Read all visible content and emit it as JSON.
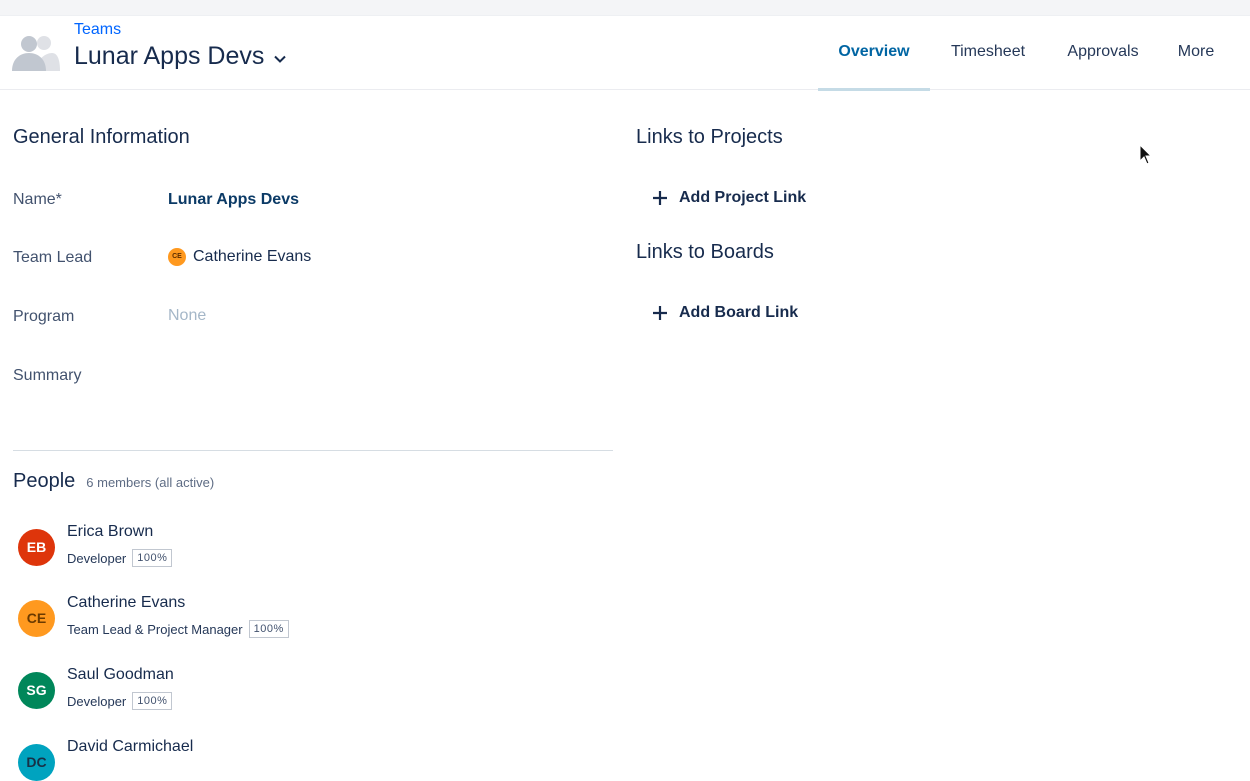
{
  "header": {
    "breadcrumb": "Teams",
    "team_name": "Lunar Apps Devs",
    "icons": {
      "team": "team-people-icon",
      "dropdown": "chevron-down-icon"
    },
    "tabs": [
      {
        "label": "Overview",
        "active": true
      },
      {
        "label": "Timesheet",
        "active": false
      },
      {
        "label": "Approvals",
        "active": false
      },
      {
        "label": "More",
        "active": false
      }
    ]
  },
  "general": {
    "title": "General Information",
    "fields": {
      "name": {
        "label": "Name*",
        "value": "Lunar Apps Devs"
      },
      "team_lead": {
        "label": "Team Lead",
        "value": "Catherine Evans",
        "initials": "CE"
      },
      "program": {
        "label": "Program",
        "value": "None"
      },
      "summary": {
        "label": "Summary",
        "value": ""
      }
    }
  },
  "people": {
    "title": "People",
    "count_text": "6 members (all active)",
    "members": [
      {
        "initials": "EB",
        "name": "Erica Brown",
        "role": "Developer",
        "allocation": "100%",
        "color": "#de350b"
      },
      {
        "initials": "CE",
        "name": "Catherine Evans",
        "role": "Team Lead & Project Manager",
        "allocation": "100%",
        "color": "#ff991f"
      },
      {
        "initials": "SG",
        "name": "Saul Goodman",
        "role": "Developer",
        "allocation": "100%",
        "color": "#00875a"
      },
      {
        "initials": "DC",
        "name": "David Carmichael",
        "role": "",
        "allocation": "",
        "color": "#00a3bf"
      }
    ]
  },
  "links": {
    "projects_title": "Links to Projects",
    "add_project": "Add Project Link",
    "boards_title": "Links to Boards",
    "add_board": "Add Board Link",
    "icon": "plus-icon"
  },
  "colors": {
    "accent": "#0065ff",
    "active_tab": "#0065a3",
    "text": "#172b4d"
  }
}
